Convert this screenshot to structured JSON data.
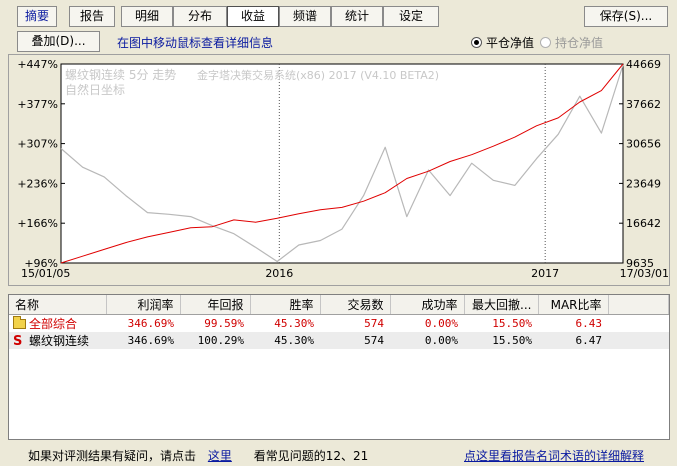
{
  "tabs": [
    {
      "label": "摘要",
      "active": false
    },
    {
      "label": "报告",
      "active": false
    },
    {
      "label": "明细",
      "active": false
    },
    {
      "label": "分布",
      "active": false
    },
    {
      "label": "收益",
      "active": true
    },
    {
      "label": "频谱",
      "active": false
    },
    {
      "label": "统计",
      "active": false
    },
    {
      "label": "设定",
      "active": false
    }
  ],
  "toolbar": {
    "save_label": "保存(S)...",
    "overlay_label": "叠加(D)...",
    "hint": "在图中移动鼠标查看详细信息"
  },
  "options": {
    "flat_nav_label": "平仓净值",
    "flat_nav_selected": true,
    "hold_nav_label": "持仓净值",
    "hold_nav_enabled": false
  },
  "chart_data": {
    "type": "line",
    "title": "螺纹钢连续 5分 走势",
    "subtitle": "金字塔决策交易系统(x86) 2017 (V4.10 BETA2)",
    "note": "自然日坐标",
    "x_ticks": [
      "15/01/05",
      "2016",
      "2017",
      "17/03/01"
    ],
    "y_left_ticks": [
      "+447%",
      "+377%",
      "+307%",
      "+236%",
      "+166%",
      "+96%"
    ],
    "y_right_ticks": [
      "44669",
      "37662",
      "30656",
      "23649",
      "16642",
      "9635"
    ],
    "x_range": [
      0,
      26
    ],
    "y_left_range": [
      96,
      447
    ],
    "y_right_range": [
      9635,
      44669
    ],
    "series": [
      {
        "color": "#e00000",
        "axis": "left",
        "x": [
          0,
          1,
          2,
          3,
          4,
          5,
          6,
          7,
          8,
          9,
          10,
          11,
          12,
          13,
          14,
          15,
          16,
          17,
          18,
          19,
          20,
          21,
          22,
          23,
          24,
          25,
          26
        ],
        "y": [
          96,
          108,
          120,
          132,
          142,
          150,
          158,
          160,
          172,
          168,
          175,
          183,
          190,
          194,
          205,
          220,
          245,
          258,
          275,
          287,
          302,
          318,
          338,
          352,
          380,
          400,
          447
        ]
      },
      {
        "color": "#b8b8b8",
        "axis": "right",
        "x": [
          0,
          1,
          2,
          3,
          4,
          5,
          6,
          7,
          8,
          9,
          10,
          11,
          12,
          13,
          14,
          15,
          16,
          17,
          18,
          19,
          20,
          21,
          22,
          23,
          24,
          25,
          26
        ],
        "y": [
          29800,
          26500,
          24800,
          21500,
          18500,
          18200,
          17800,
          16200,
          14800,
          12400,
          9900,
          12800,
          13600,
          15600,
          21500,
          30000,
          17800,
          26000,
          21500,
          27200,
          24200,
          23300,
          28000,
          32300,
          39000,
          32500,
          44500
        ]
      }
    ]
  },
  "table": {
    "columns": [
      "名称",
      "利润率",
      "年回报",
      "胜率",
      "交易数",
      "成功率",
      "最大回撤...",
      "MAR比率"
    ],
    "rows": [
      {
        "icon": "folder-icon",
        "cells": [
          "全部综合",
          "346.69%",
          "99.59%",
          "45.30%",
          "574",
          "0.00%",
          "15.50%",
          "6.43"
        ]
      },
      {
        "icon": "s-icon",
        "icon_text": "S",
        "cells": [
          "螺纹钢连续",
          "346.69%",
          "100.29%",
          "45.30%",
          "574",
          "0.00%",
          "15.50%",
          "6.47"
        ]
      }
    ]
  },
  "footer": {
    "prefix": "如果对评测结果有疑问，请点击",
    "link": "这里",
    "suffix": "看常见问题的12、21",
    "right_link": "点这里看报告名词术语的详细解释"
  }
}
